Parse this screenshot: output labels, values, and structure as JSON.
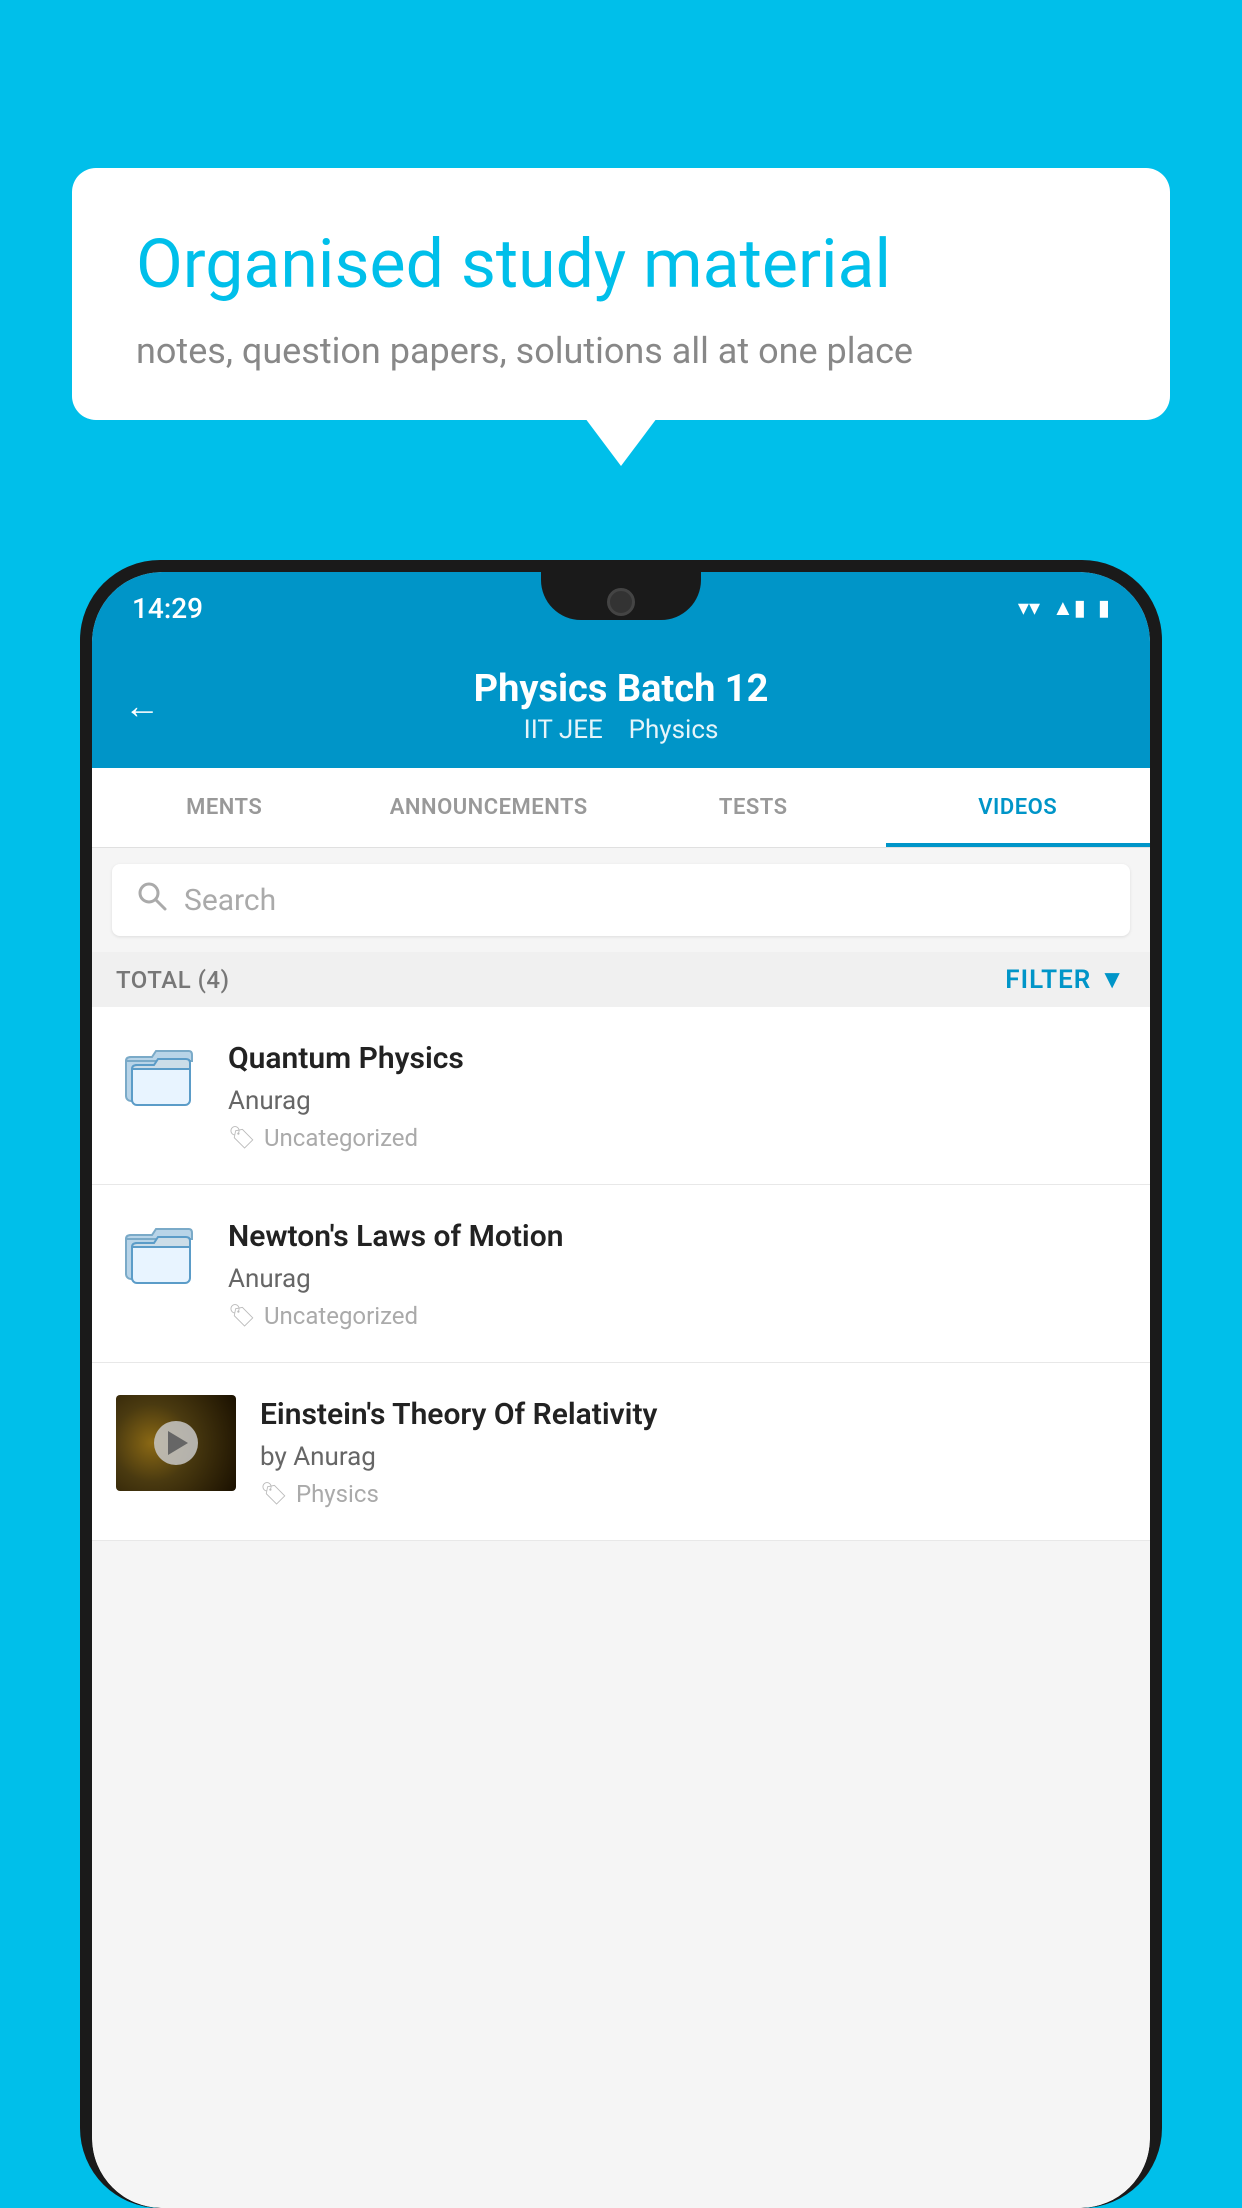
{
  "background_color": "#00BFEA",
  "bubble": {
    "title": "Organised study material",
    "subtitle": "notes, question papers, solutions all at one place"
  },
  "status_bar": {
    "time": "14:29",
    "wifi": "▼▲",
    "signal": "▲",
    "battery": "▮"
  },
  "header": {
    "title": "Physics Batch 12",
    "subtitle_left": "IIT JEE",
    "subtitle_right": "Physics",
    "back_label": "←"
  },
  "tabs": [
    {
      "label": "MENTS",
      "active": false
    },
    {
      "label": "ANNOUNCEMENTS",
      "active": false
    },
    {
      "label": "TESTS",
      "active": false
    },
    {
      "label": "VIDEOS",
      "active": true
    }
  ],
  "search": {
    "placeholder": "Search"
  },
  "filter": {
    "total_label": "TOTAL (4)",
    "filter_label": "FILTER"
  },
  "videos": [
    {
      "title": "Quantum Physics",
      "author": "Anurag",
      "tag": "Uncategorized",
      "type": "folder",
      "has_thumbnail": false
    },
    {
      "title": "Newton's Laws of Motion",
      "author": "Anurag",
      "tag": "Uncategorized",
      "type": "folder",
      "has_thumbnail": false
    },
    {
      "title": "Einstein's Theory Of Relativity",
      "author": "by Anurag",
      "tag": "Physics",
      "type": "video",
      "has_thumbnail": true
    }
  ]
}
